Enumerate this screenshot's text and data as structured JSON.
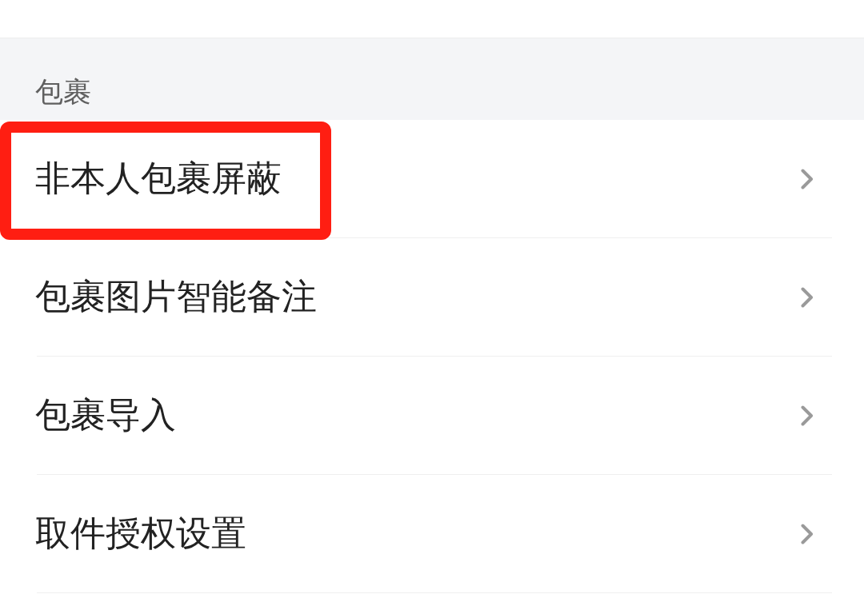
{
  "section": {
    "title": "包裹"
  },
  "items": [
    {
      "label": "非本人包裹屏蔽",
      "highlighted": true
    },
    {
      "label": "包裹图片智能备注",
      "highlighted": false
    },
    {
      "label": "包裹导入",
      "highlighted": false
    },
    {
      "label": "取件授权设置",
      "highlighted": false
    }
  ]
}
